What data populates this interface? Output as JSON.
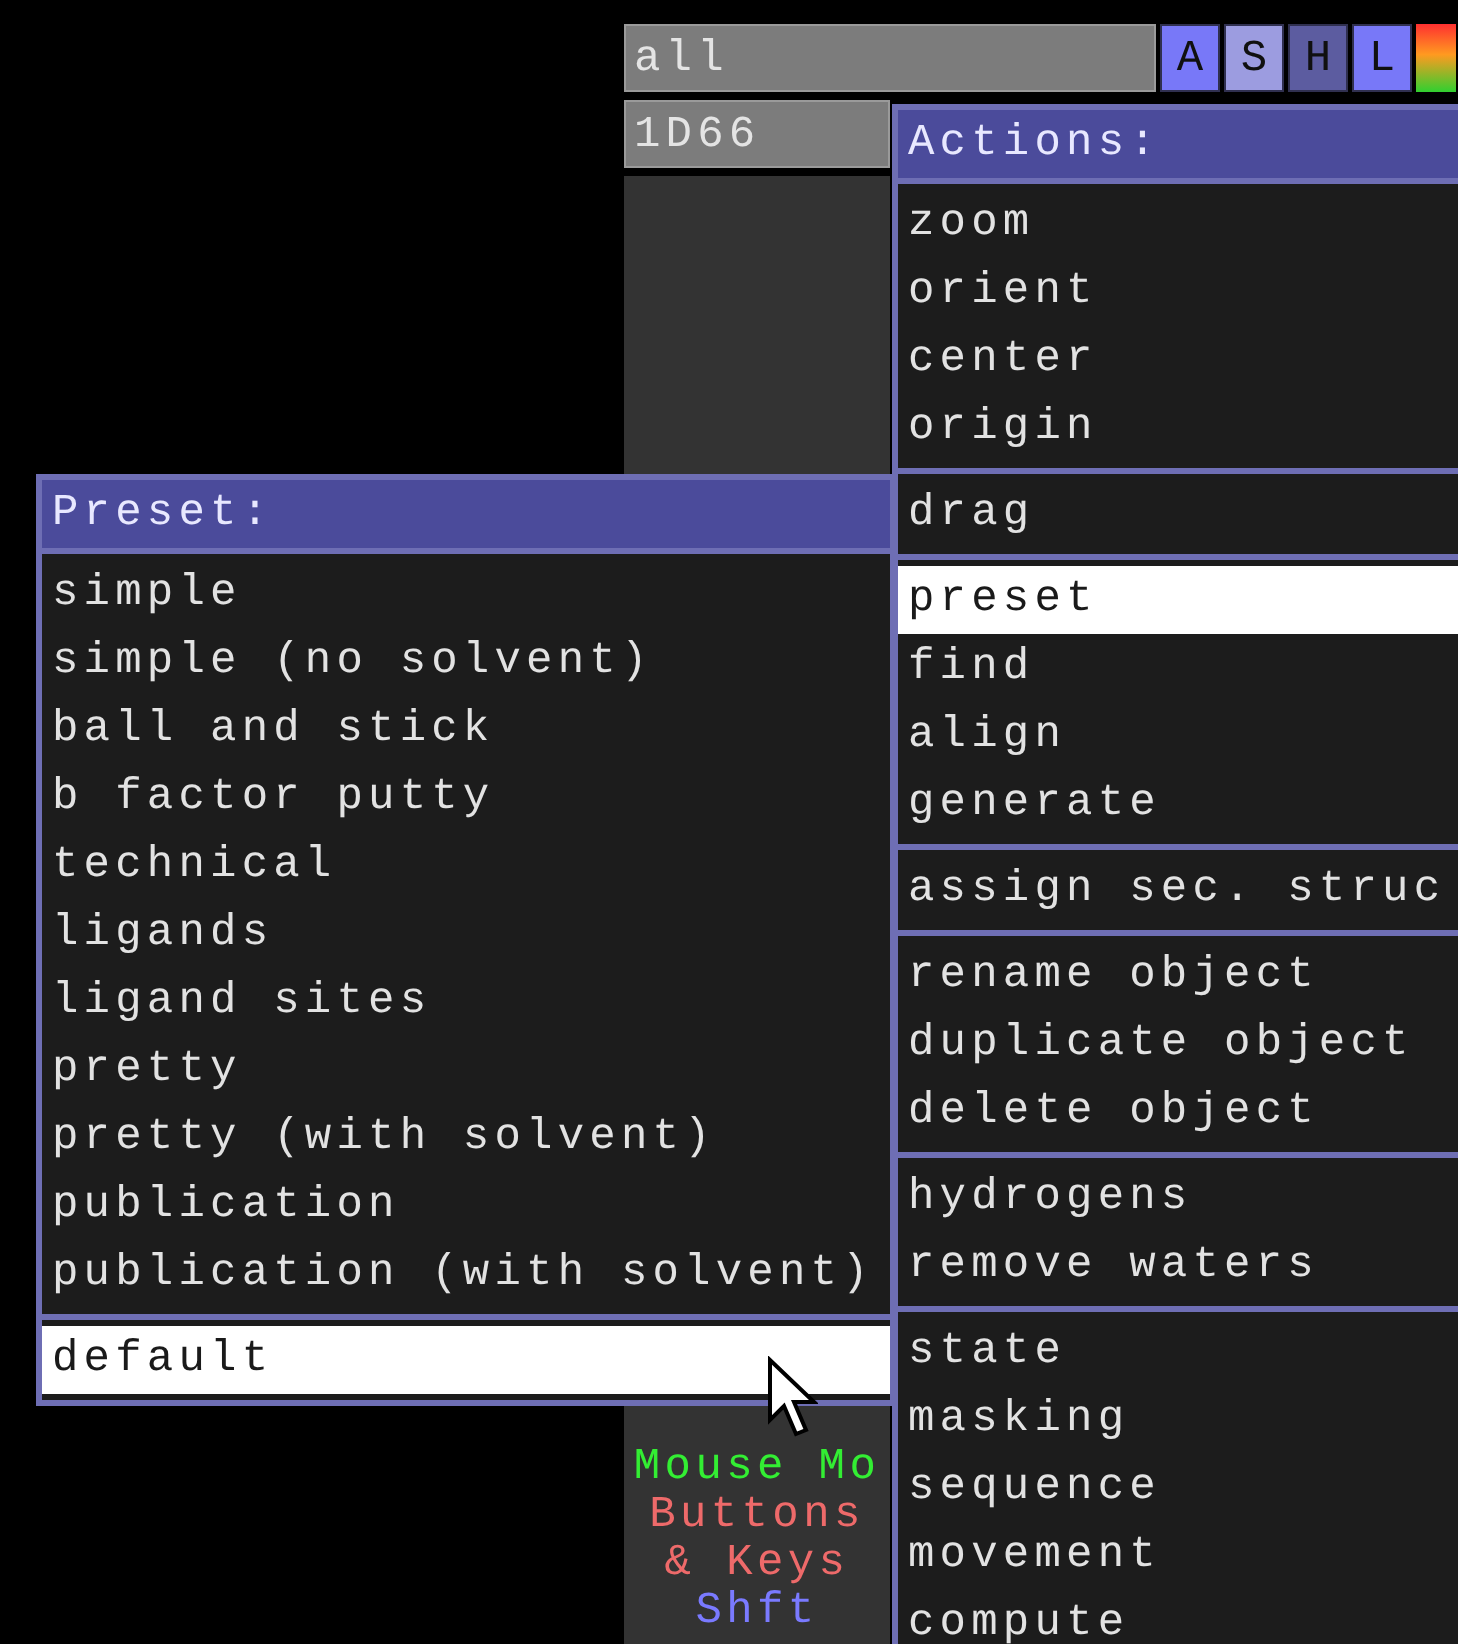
{
  "object_panel": {
    "objects": [
      {
        "name": "all",
        "buttons": [
          {
            "label": "A",
            "color": "#7878f8"
          },
          {
            "label": "S",
            "color": "#9c9ce0"
          },
          {
            "label": "H",
            "color": "#5c5ca0"
          },
          {
            "label": "L",
            "color": "#7878f8"
          }
        ]
      },
      {
        "name": "1D66"
      }
    ],
    "mouse_mode": [
      {
        "text": "Mouse Mo",
        "color": "#33ee33"
      },
      {
        "text": "Buttons",
        "color": "#ee6a6a"
      },
      {
        "text": "& Keys",
        "color": "#ee6a6a"
      },
      {
        "text": "Shft",
        "color": "#7a7aff"
      }
    ]
  },
  "actions_menu": {
    "title": "Actions:",
    "groups": [
      [
        {
          "label": "zoom",
          "selected": false
        },
        {
          "label": "orient",
          "selected": false
        },
        {
          "label": "center",
          "selected": false
        },
        {
          "label": "origin",
          "selected": false
        }
      ],
      [
        {
          "label": "drag",
          "selected": false
        }
      ],
      [
        {
          "label": "preset",
          "selected": true
        },
        {
          "label": "find",
          "selected": false
        },
        {
          "label": "align",
          "selected": false
        },
        {
          "label": "generate",
          "selected": false
        }
      ],
      [
        {
          "label": "assign sec. struc",
          "selected": false
        }
      ],
      [
        {
          "label": "rename object",
          "selected": false
        },
        {
          "label": "duplicate object",
          "selected": false
        },
        {
          "label": "delete object",
          "selected": false
        }
      ],
      [
        {
          "label": "hydrogens",
          "selected": false
        },
        {
          "label": "remove waters",
          "selected": false
        }
      ],
      [
        {
          "label": "state",
          "selected": false
        },
        {
          "label": "masking",
          "selected": false
        },
        {
          "label": "sequence",
          "selected": false
        },
        {
          "label": "movement",
          "selected": false
        },
        {
          "label": "compute",
          "selected": false
        }
      ]
    ]
  },
  "preset_menu": {
    "title": "Preset:",
    "groups": [
      [
        {
          "label": "simple",
          "selected": false
        },
        {
          "label": "simple (no solvent)",
          "selected": false
        },
        {
          "label": "ball and stick",
          "selected": false
        },
        {
          "label": "b factor putty",
          "selected": false
        },
        {
          "label": "technical",
          "selected": false
        },
        {
          "label": "ligands",
          "selected": false
        },
        {
          "label": "ligand sites",
          "selected": false
        },
        {
          "label": "pretty",
          "selected": false
        },
        {
          "label": "pretty (with solvent)",
          "selected": false
        },
        {
          "label": "publication",
          "selected": false
        },
        {
          "label": "publication (with solvent)",
          "selected": false
        }
      ],
      [
        {
          "label": "default",
          "selected": true
        }
      ]
    ]
  }
}
